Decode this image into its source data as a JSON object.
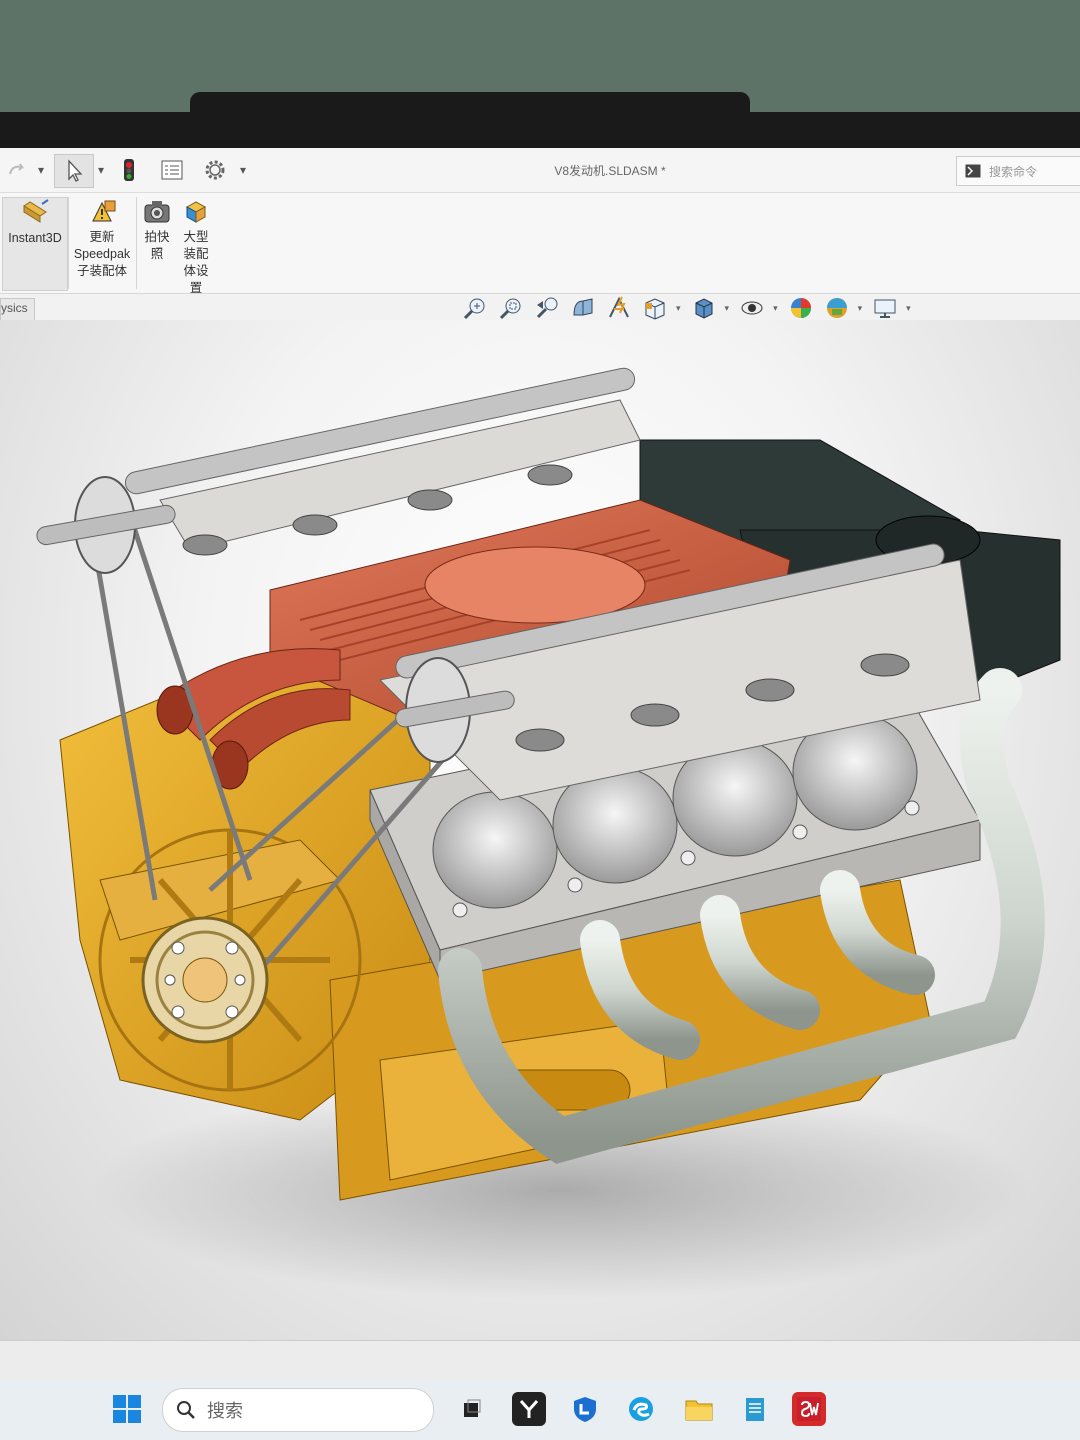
{
  "window": {
    "document_title": "V8发动机.SLDASM *"
  },
  "search": {
    "placeholder": "搜索命令"
  },
  "ribbon": {
    "instant3d": "Instant3D",
    "update_speedpak_1": "更新",
    "update_speedpak_2": "Speedpak",
    "update_speedpak_3": "子装配体",
    "snapshot_1": "拍快",
    "snapshot_2": "照",
    "large_asm_1": "大型",
    "large_asm_2": "装配",
    "large_asm_3": "体设",
    "large_asm_4": "置"
  },
  "tabs": {
    "physics_partial": "ysics"
  },
  "heads_up_toolbar": [
    "zoom-to-fit-icon",
    "zoom-to-area-icon",
    "previous-view-icon",
    "section-view-icon",
    "dynamic-annotation-icon",
    "view-orientation-icon",
    "display-style-icon",
    "hide-show-items-icon",
    "edit-appearance-icon",
    "apply-scene-icon",
    "view-settings-icon"
  ],
  "taskbar": {
    "search_label": "搜索"
  },
  "colors": {
    "engine_block": "#e0a82a",
    "intake_plenum": "#c8553d",
    "heads": "#c9c9c6",
    "airbox": "#2d3a38",
    "exhaust": "#cfd6cf",
    "viewport_bg": "#f3f3f3"
  }
}
